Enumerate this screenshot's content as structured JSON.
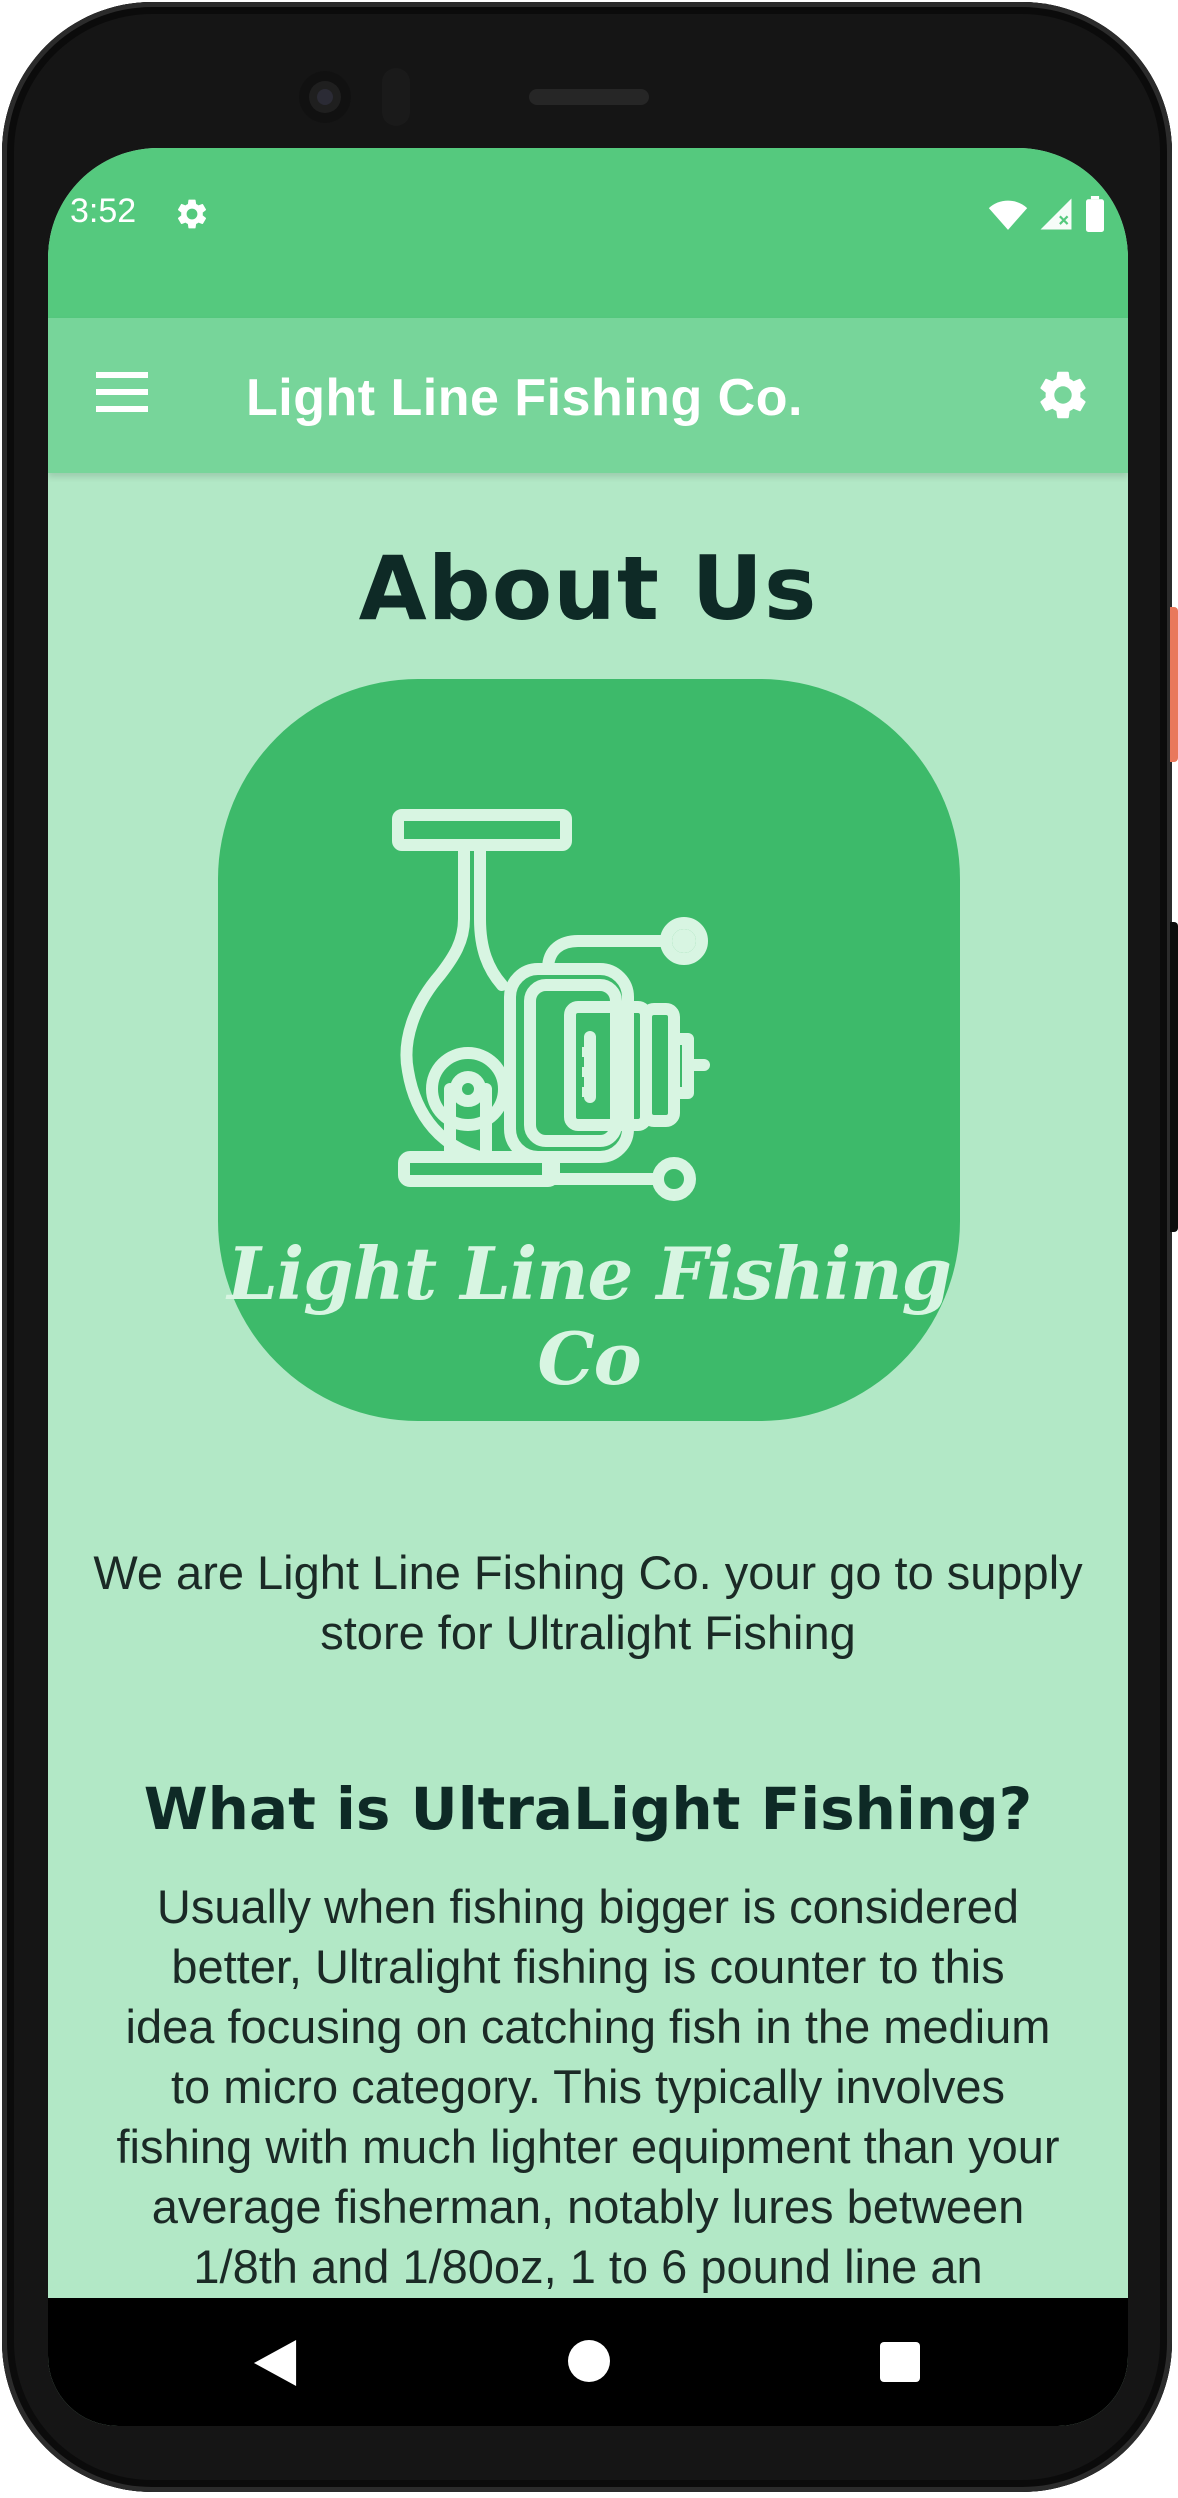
{
  "status_bar": {
    "time": "3:52",
    "icons": [
      "gear-icon",
      "wifi-icon",
      "signal-icon",
      "battery-icon"
    ]
  },
  "app_bar": {
    "title": "Light Line Fishing Co.",
    "menu_icon": "hamburger-menu-icon",
    "settings_icon": "gear-icon"
  },
  "main": {
    "heading": "About Us",
    "logo_text": "Light Line Fishing Co",
    "intro_line1": "We are Light Line Fishing Co. your go to supply",
    "intro_line2": "store for Ultralight Fishing",
    "section_heading": "What is UltraLight Fishing?",
    "body_lines": [
      "Usually when fishing bigger is considered",
      "better, Ultralight fishing is counter to this",
      "idea focusing on catching fish in the medium",
      "to micro category. This typically involves",
      "fishing with much lighter equipment than your",
      "average fisherman, notably lures between",
      "1/8th and 1/80oz, 1 to 6 pound line an"
    ]
  },
  "nav_bar": {
    "back_icon": "back-triangle-icon",
    "home_icon": "home-circle-icon",
    "recents_icon": "recents-square-icon"
  },
  "colors": {
    "status_bar": "#55c97e",
    "app_bar": "#77d59a",
    "background": "#b2e8c6",
    "logo_tile": "#3dba6a",
    "heading_text": "#0e2a26"
  }
}
